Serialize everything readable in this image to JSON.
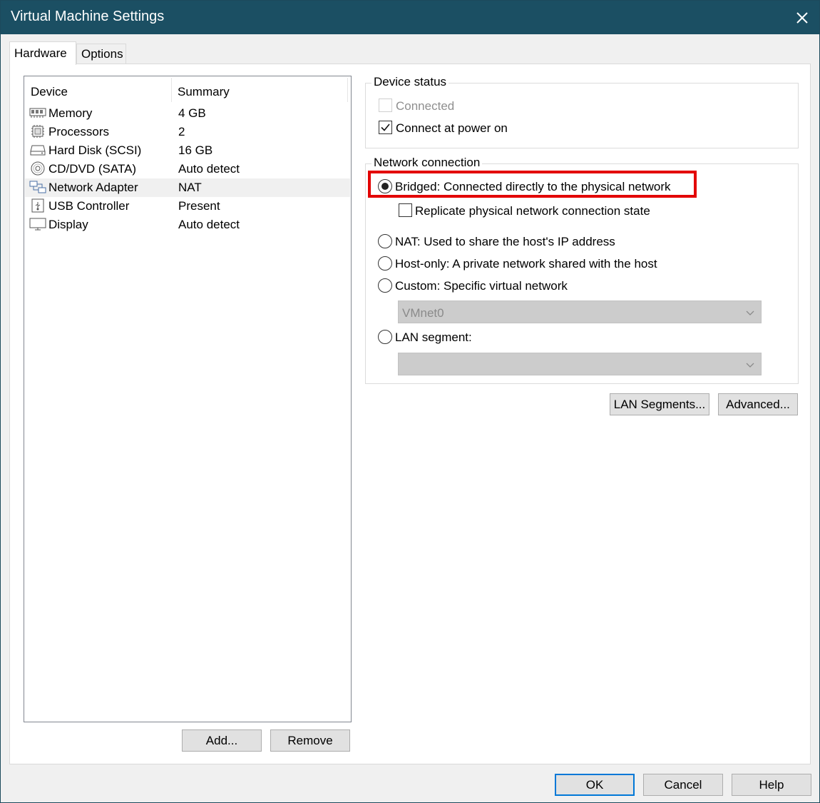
{
  "window": {
    "title": "Virtual Machine Settings"
  },
  "tabs": [
    {
      "label": "Hardware"
    },
    {
      "label": "Options"
    }
  ],
  "devices": {
    "headers": {
      "device": "Device",
      "summary": "Summary"
    },
    "rows": [
      {
        "icon": "memory-icon",
        "name": "Memory",
        "summary": "4 GB"
      },
      {
        "icon": "processor-icon",
        "name": "Processors",
        "summary": "2"
      },
      {
        "icon": "hard-disk-icon",
        "name": "Hard Disk (SCSI)",
        "summary": "16 GB"
      },
      {
        "icon": "cd-dvd-icon",
        "name": "CD/DVD (SATA)",
        "summary": "Auto detect"
      },
      {
        "icon": "network-adapter-icon",
        "name": "Network Adapter",
        "summary": "NAT",
        "selected": true
      },
      {
        "icon": "usb-icon",
        "name": "USB Controller",
        "summary": "Present"
      },
      {
        "icon": "display-icon",
        "name": "Display",
        "summary": "Auto detect"
      }
    ],
    "add_label": "Add...",
    "remove_label": "Remove"
  },
  "device_status": {
    "legend": "Device status",
    "connected": {
      "label": "Connected",
      "checked": false,
      "disabled": true
    },
    "connect_at_power_on": {
      "label": "Connect at power on",
      "checked": true
    }
  },
  "network": {
    "legend": "Network connection",
    "bridged": {
      "label": "Bridged: Connected directly to the physical network",
      "selected": true
    },
    "replicate": {
      "label": "Replicate physical network connection state",
      "checked": false
    },
    "nat": {
      "label": "NAT: Used to share the host's IP address",
      "selected": false
    },
    "host_only": {
      "label": "Host-only: A private network shared with the host",
      "selected": false
    },
    "custom": {
      "label": "Custom: Specific virtual network",
      "selected": false
    },
    "custom_select": {
      "value": "VMnet0"
    },
    "lan_segment": {
      "label": "LAN segment:",
      "selected": false
    },
    "lan_select": {
      "value": ""
    },
    "lan_segments_button": "LAN Segments...",
    "advanced_button": "Advanced..."
  },
  "footer": {
    "ok": "OK",
    "cancel": "Cancel",
    "help": "Help"
  },
  "colors": {
    "titlebar": "#1b4f63",
    "highlight": "#e30000",
    "default_button_border": "#0078d7"
  }
}
